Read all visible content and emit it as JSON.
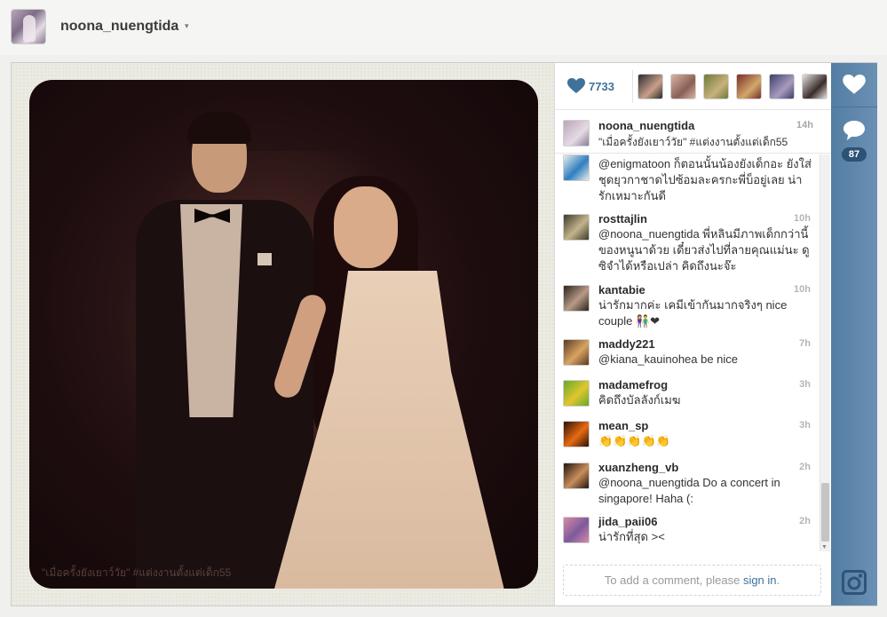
{
  "header": {
    "username": "noona_nuengtida",
    "caret": "▾"
  },
  "photo": {
    "watermark_caption": "\"เมื่อครั้งยังเยาว์วัย\" #แต่งงานตั้งแต่เด็ก55"
  },
  "likes": {
    "count": "7733",
    "likers": [
      {
        "colors": [
          "#2b2a2e",
          "#c9a08a"
        ]
      },
      {
        "colors": [
          "#d9b4a4",
          "#8a5f56"
        ]
      },
      {
        "colors": [
          "#6f7a3c",
          "#c7b27a"
        ]
      },
      {
        "colors": [
          "#7a2e2a",
          "#d1a86a"
        ]
      },
      {
        "colors": [
          "#3c3f6e",
          "#a89bbd"
        ]
      },
      {
        "colors": [
          "#e7e3df",
          "#3a2c2a"
        ]
      }
    ]
  },
  "caption": {
    "username": "noona_nuengtida",
    "time": "14h",
    "text": "\"เมื่อครั้งยังเยาว์วัย\" #แต่งงานตั้งแต่เด็ก55"
  },
  "comments": [
    {
      "username": "",
      "time": "",
      "text": "@enigmatoon ก็ตอนนั้นน้องยังเด็กอะ ยังใส่ชุดยุวกาชาดไปซ้อมละครกะพี่บ็อยู่เลย น่ารักเหมาะกันดี",
      "colors": [
        "#e8ecef",
        "#2f7fbf"
      ]
    },
    {
      "username": "rosttajlin",
      "time": "10h",
      "text": "@noona_nuengtida พี่หลินมีภาพเด็กกว่านี้ของหนูนาด้วย เดี๋ยวส่งไปที่ลายคุณแม่นะ ดูซิจำได้หรือเปล่า คิดถึงนะจ๊ะ",
      "colors": [
        "#3b3a2a",
        "#c3b48d"
      ]
    },
    {
      "username": "kantabie",
      "time": "10h",
      "text": "น่ารักมากค่ะ เคมีเข้ากันมากจริงๆ nice couple 👫❤",
      "colors": [
        "#2a2420",
        "#b89a86"
      ]
    },
    {
      "username": "maddy221",
      "time": "7h",
      "text": "@kiana_kauinohea be nice",
      "colors": [
        "#5b3a22",
        "#d9a463"
      ]
    },
    {
      "username": "madamefrog",
      "time": "3h",
      "text": "คิดถึงบัลลังก์เมฆ",
      "colors": [
        "#63a92d",
        "#e1c62f"
      ]
    },
    {
      "username": "mean_sp",
      "time": "3h",
      "text": "👏👏👏👏👏",
      "colors": [
        "#2a1208",
        "#e86b12"
      ]
    },
    {
      "username": "xuanzheng_vb",
      "time": "2h",
      "text": "@noona_nuengtida Do a concert in singapore! Haha (:",
      "colors": [
        "#22150f",
        "#c98e5c"
      ]
    },
    {
      "username": "jida_paii06",
      "time": "2h",
      "text": "น่ารักที่สุด ><",
      "colors": [
        "#d88aa7",
        "#7d5a9c"
      ]
    }
  ],
  "add_comment": {
    "prefix": "To add a comment, please ",
    "link": "sign in",
    "suffix": "."
  },
  "rail": {
    "comment_count": "87"
  }
}
